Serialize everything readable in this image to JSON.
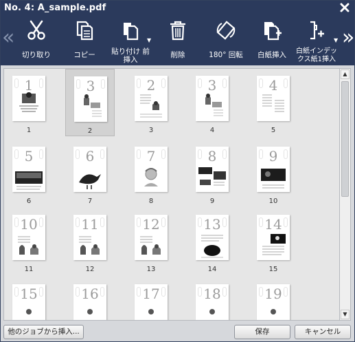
{
  "window": {
    "title": "No. 4: A_sample.pdf"
  },
  "toolbar": {
    "nav_left": "«",
    "nav_right": "»",
    "tools": [
      {
        "id": "cut",
        "label": "切り取り",
        "icon": "scissors-icon"
      },
      {
        "id": "copy",
        "label": "コピー",
        "icon": "copy-icon"
      },
      {
        "id": "paste",
        "label": "貼り付け 前挿入",
        "icon": "paste-icon",
        "has_dropdown": true
      },
      {
        "id": "delete",
        "label": "削除",
        "icon": "trash-icon"
      },
      {
        "id": "rotate",
        "label": "180° 回転",
        "icon": "rotate-icon"
      },
      {
        "id": "blank",
        "label": "白紙挿入",
        "icon": "blank-page-icon"
      },
      {
        "id": "index",
        "label": "白紙インデックス紙1挿入",
        "icon": "index-tab-icon",
        "has_dropdown": true
      }
    ]
  },
  "pages": [
    {
      "number": "1",
      "caption": "1",
      "art": "title",
      "selected": false
    },
    {
      "number": "3",
      "caption": "2",
      "art": "figure-sit",
      "selected": true
    },
    {
      "number": "2",
      "caption": "3",
      "art": "text-figure",
      "selected": false
    },
    {
      "number": "3",
      "caption": "4",
      "art": "figure-sit",
      "selected": false
    },
    {
      "number": "4",
      "caption": "5",
      "art": "text",
      "selected": false
    },
    {
      "number": "5",
      "caption": "6",
      "art": "photo",
      "selected": false
    },
    {
      "number": "6",
      "caption": "7",
      "art": "bird",
      "selected": false
    },
    {
      "number": "7",
      "caption": "8",
      "art": "boy",
      "selected": false
    },
    {
      "number": "8",
      "caption": "9",
      "art": "photos",
      "selected": false
    },
    {
      "number": "9",
      "caption": "10",
      "art": "photo-big",
      "selected": false
    },
    {
      "number": "10",
      "caption": "11",
      "art": "figures",
      "selected": false
    },
    {
      "number": "11",
      "caption": "12",
      "art": "figures",
      "selected": false
    },
    {
      "number": "12",
      "caption": "13",
      "art": "figures",
      "selected": false
    },
    {
      "number": "13",
      "caption": "14",
      "art": "dark",
      "selected": false
    },
    {
      "number": "14",
      "caption": "15",
      "art": "dark-top",
      "selected": false
    },
    {
      "number": "15",
      "caption": "",
      "art": "partial",
      "selected": false
    },
    {
      "number": "16",
      "caption": "",
      "art": "partial",
      "selected": false
    },
    {
      "number": "17",
      "caption": "",
      "art": "partial",
      "selected": false
    },
    {
      "number": "18",
      "caption": "",
      "art": "partial",
      "selected": false
    },
    {
      "number": "19",
      "caption": "",
      "art": "partial",
      "selected": false
    }
  ],
  "scrollbar": {
    "up": "▲",
    "down": "▼"
  },
  "footer": {
    "insert_label": "他のジョブから挿入...",
    "save_label": "保存",
    "cancel_label": "キャンセル"
  },
  "colors": {
    "titlebar": "#2b3a5c",
    "toolbar": "#2b3a5c",
    "content_bg": "#e6e6e6",
    "selected_bg": "#d2d2d2"
  }
}
